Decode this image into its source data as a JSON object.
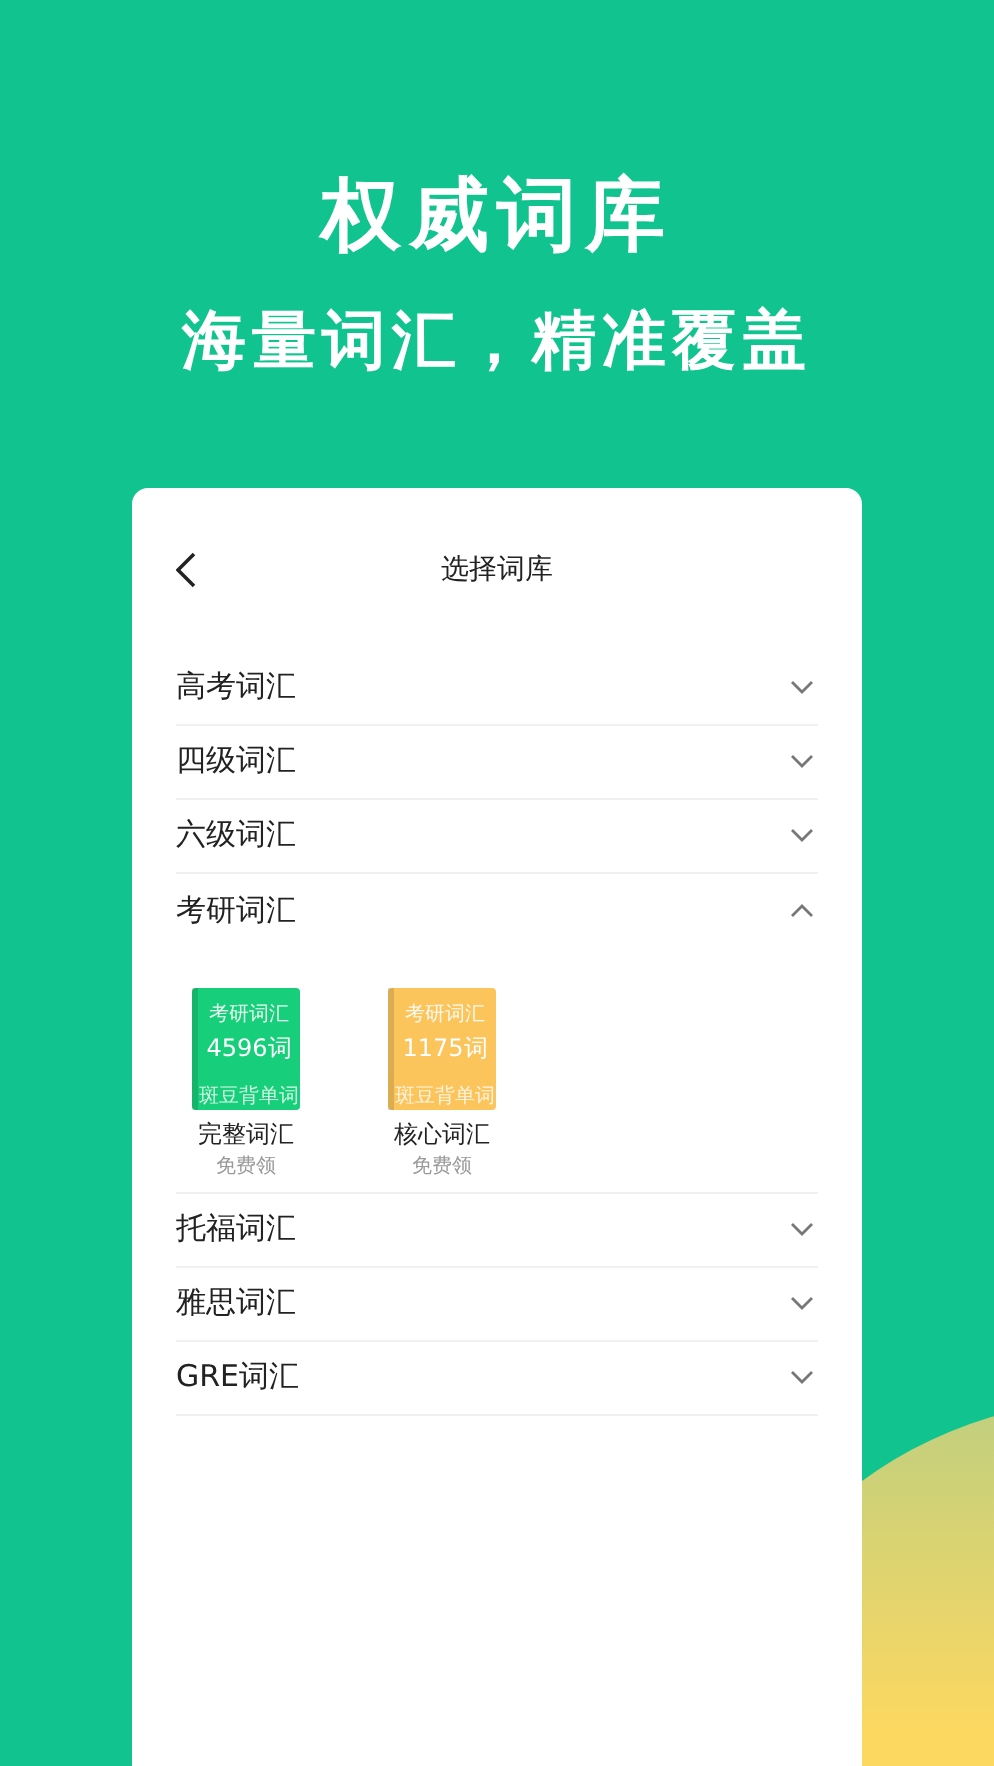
{
  "headline": "权威词库",
  "subheadline": "海量词汇，精准覆盖",
  "panel": {
    "title": "选择词库"
  },
  "categories": [
    {
      "label": "高考词汇",
      "expanded": false
    },
    {
      "label": "四级词汇",
      "expanded": false
    },
    {
      "label": "六级词汇",
      "expanded": false
    },
    {
      "label": "考研词汇",
      "expanded": true,
      "books": [
        {
          "cover_label": "考研词汇",
          "cover_count": "4596词",
          "cover_brand": "斑豆背单词",
          "name": "完整词汇",
          "note": "免费领",
          "color": "#17cf7a"
        },
        {
          "cover_label": "考研词汇",
          "cover_count": "1175词",
          "cover_brand": "斑豆背单词",
          "name": "核心词汇",
          "note": "免费领",
          "color": "#fbc55c"
        }
      ]
    },
    {
      "label": "托福词汇",
      "expanded": false
    },
    {
      "label": "雅思词汇",
      "expanded": false
    },
    {
      "label": "GRE词汇",
      "expanded": false
    }
  ]
}
